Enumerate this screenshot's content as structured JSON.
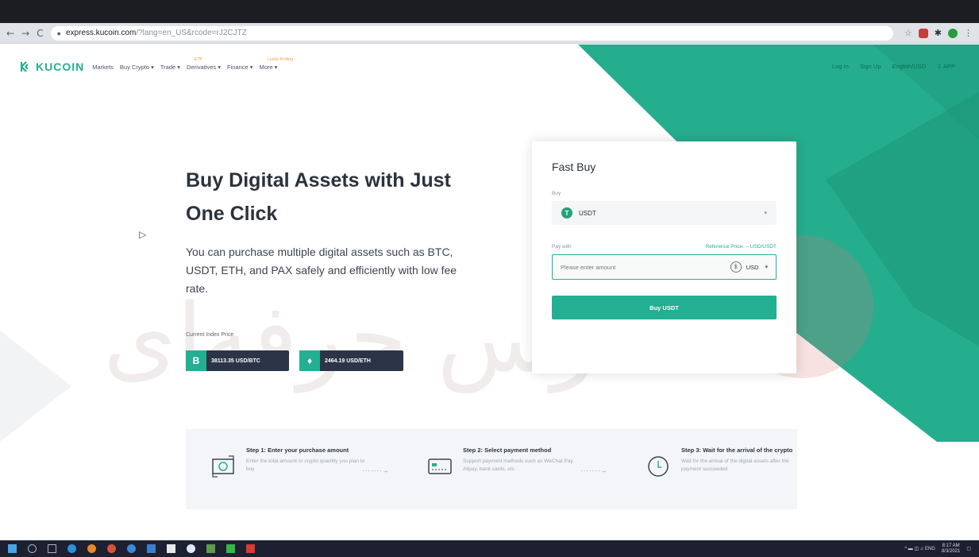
{
  "browser": {
    "nav": {
      "back": "←",
      "forward": "→",
      "reload": "C"
    },
    "url_domain": "express.kucoin.com",
    "url_path": "/?lang=en_US&rcode=rJ2CJTZ",
    "ext": {
      "star": "☆",
      "puzzle": "✱",
      "menu": "⋮"
    }
  },
  "site": {
    "logo": "KUCOIN",
    "nav": {
      "markets": "Markets",
      "buy_crypto": "Buy Crypto ▾",
      "trade": "Trade ▾",
      "derivatives": "Derivatives ▾",
      "derivatives_badge": "ETF",
      "finance": "Finance ▾",
      "more": "More ▾",
      "more_badge": "Lucky Rolling"
    },
    "nav_right": {
      "login": "Log In",
      "signup": "Sign Up",
      "lang": "English/USD",
      "app": "⇩ APP"
    }
  },
  "hero": {
    "title": "Buy Digital Assets with Just One Click",
    "desc": "You can purchase multiple digital assets such as BTC, USDT, ETH, and PAX safely and efficiently with low fee rate.",
    "index_label": "Current Index Price",
    "btc_price": "38113.35 USD/BTC",
    "eth_price": "2464.19 USD/ETH",
    "btc_symbol": "B",
    "eth_symbol": "♦"
  },
  "watermark": "فارس حرفه‌ای",
  "fast_buy": {
    "title": "Fast Buy",
    "buy_label": "Buy",
    "buy_coin": "USDT",
    "coin_symbol": "T",
    "chevron": "▾",
    "pay_label": "Pay with",
    "ref_price": "Reference Price: -- USD/USDT",
    "amount_placeholder": "Please enter amount",
    "currency": "USD",
    "dollar_symbol": "$",
    "buy_button": "Buy USDT"
  },
  "steps": [
    {
      "title": "Step 1: Enter your purchase amount",
      "desc": "Enter the total amount or crypto quantity you plan to buy"
    },
    {
      "title": "Step 2: Select payment method",
      "desc": "Support payment methods such as WeChat Pay, Alipay, bank cards, etc."
    },
    {
      "title": "Step 3: Wait for the arrival of the crypto",
      "desc": "Wait for the arrival of the digital assets after the payment succeeded"
    }
  ],
  "step_arrow": "·······→",
  "taskbar": {
    "tray": "^ ▬ ◫ ♫ ENG",
    "time": "8:17 AM",
    "date": "8/3/2021"
  }
}
